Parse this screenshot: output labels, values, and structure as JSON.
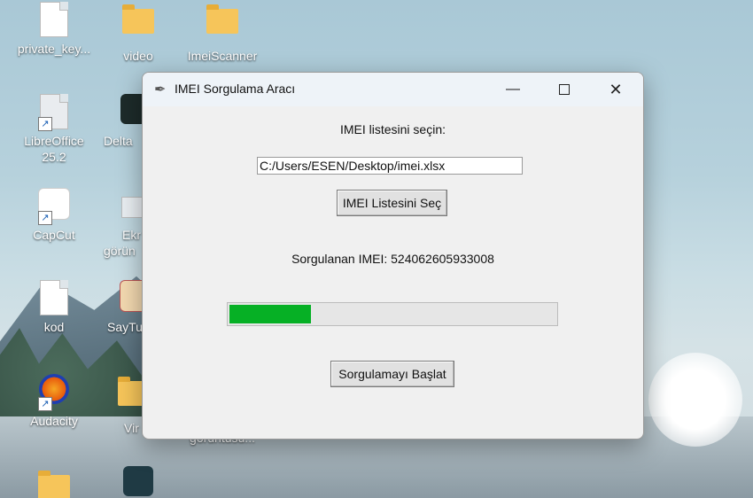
{
  "desktop": {
    "icons": [
      {
        "label": "private_key...",
        "icon": "document-icon"
      },
      {
        "label": "video",
        "icon": "folder-icon"
      },
      {
        "label": "ImeiScanner",
        "icon": "folder-icon"
      },
      {
        "label": "LibreOffice 25.2",
        "icon": "libreoffice-icon"
      },
      {
        "label": "Delta",
        "icon": "app-icon"
      },
      {
        "label": "CapCut",
        "icon": "capcut-icon"
      },
      {
        "label": "Ekr",
        "sub": "görün",
        "icon": "image-icon"
      },
      {
        "label": "kod",
        "icon": "document-icon"
      },
      {
        "label": "SayTu",
        "icon": "app-icon"
      },
      {
        "label": "Audacity",
        "icon": "audacity-icon"
      },
      {
        "label": "Vir",
        "icon": "folder-icon"
      },
      {
        "label": "görüntüsü...",
        "icon": "image-icon"
      }
    ]
  },
  "window": {
    "title": "IMEI Sorgulama Aracı",
    "icon": "feather-icon",
    "controls": {
      "minimize": "—",
      "maximize": "☐",
      "close": "✕"
    }
  },
  "form": {
    "select_label": "IMEI listesini seçin:",
    "file_path": "C:/Users/ESEN/Desktop/imei.xlsx",
    "select_button": "IMEI Listesini Seç",
    "status_text": "Sorgulanan IMEI: 524062605933008",
    "progress_fraction": 0.25,
    "start_button": "Sorgulamayı Başlat"
  },
  "colors": {
    "progress_fill": "#06b025",
    "window_bg": "#f0f0f0"
  }
}
